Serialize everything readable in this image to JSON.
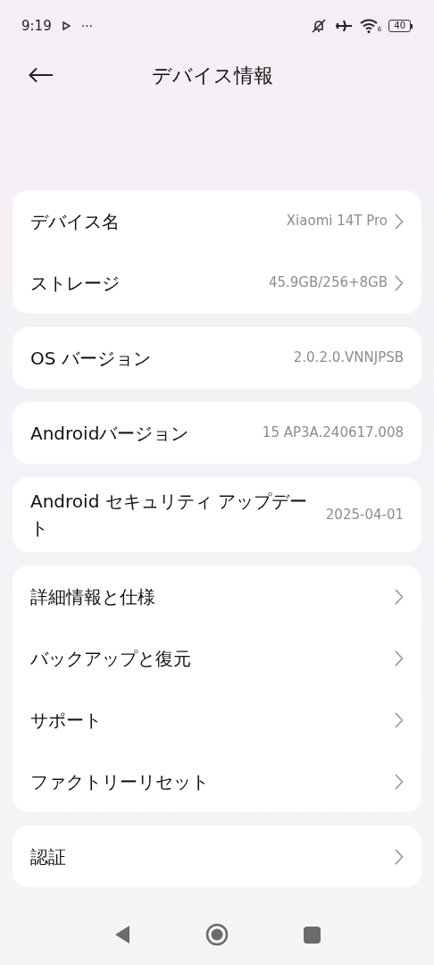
{
  "status_bar": {
    "time": "9:19",
    "dots": "···",
    "wifi_badge": "6",
    "battery": "40"
  },
  "header": {
    "title": "デバイス情報"
  },
  "groups": [
    {
      "rows": [
        {
          "label": "デバイス名",
          "value": "Xiaomi 14T Pro",
          "chevron": true
        },
        {
          "label": "ストレージ",
          "value": "45.9GB/256+8GB",
          "chevron": true
        }
      ]
    },
    {
      "rows": [
        {
          "label": "OS バージョン",
          "value": "2.0.2.0.VNNJPSB",
          "chevron": false
        }
      ]
    },
    {
      "rows": [
        {
          "label": "Androidバージョン",
          "value": "15 AP3A.240617.008",
          "chevron": false
        }
      ]
    },
    {
      "rows": [
        {
          "label": "Android セキュリティ アップデート",
          "value": "2025-04-01",
          "chevron": false
        }
      ]
    },
    {
      "rows": [
        {
          "label": "詳細情報と仕様",
          "chevron": true
        },
        {
          "label": "バックアップと復元",
          "chevron": true
        },
        {
          "label": "サポート",
          "chevron": true
        },
        {
          "label": "ファクトリーリセット",
          "chevron": true
        }
      ]
    },
    {
      "rows": [
        {
          "label": "認証",
          "chevron": true
        }
      ]
    }
  ]
}
